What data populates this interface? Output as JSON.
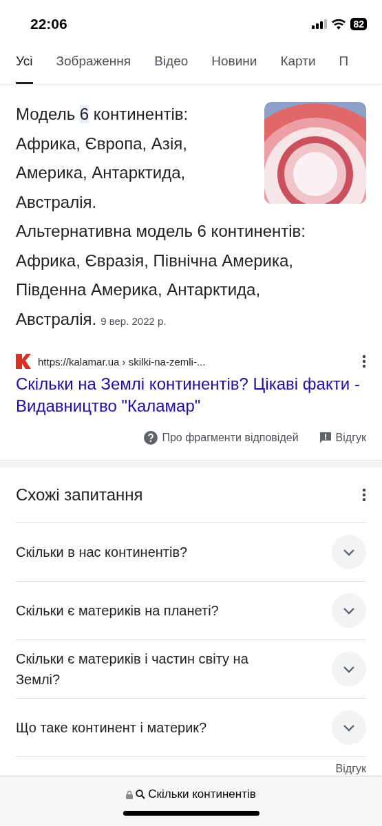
{
  "status_bar": {
    "time": "22:06",
    "battery": "82"
  },
  "tabs": [
    {
      "label": "Усі",
      "selected": true
    },
    {
      "label": "Зображення",
      "selected": false
    },
    {
      "label": "Відео",
      "selected": false
    },
    {
      "label": "Новини",
      "selected": false
    },
    {
      "label": "Карти",
      "selected": false
    },
    {
      "label": "П",
      "selected": false
    }
  ],
  "snippet": {
    "before": "Модель ",
    "highlight": "6",
    "after": " континентів: Африка, Європа, Азія, Америка, Антарктида, Австралія.",
    "paragraph_2": "Альтернативна модель 6 континентів: Африка, Євразія, Північна Америка, Південна Америка, Антарктида, Австралія.",
    "date": "9 вер. 2022 р."
  },
  "source": {
    "url": "https://kalamar.ua › skilki-na-zemli-...",
    "title": "Скільки на Землі континентів? Цікаві факти - Видавництво \"Каламар\""
  },
  "snippet_footer": {
    "about": "Про фрагменти відповідей",
    "feedback": "Відгук"
  },
  "related": {
    "title": "Схожі запитання",
    "questions": [
      {
        "text": "Скільки в нас континентів?",
        "expanded": false
      },
      {
        "text": "Скільки є материків на планеті?",
        "expanded": false
      },
      {
        "text": "Скільки є материків і частин світу на Землі?",
        "expanded": false
      },
      {
        "text": "Що таке континент і материк?",
        "expanded": false
      }
    ],
    "feedback": "Відгук"
  },
  "address_bar": {
    "query": "Скільки континентів"
  }
}
